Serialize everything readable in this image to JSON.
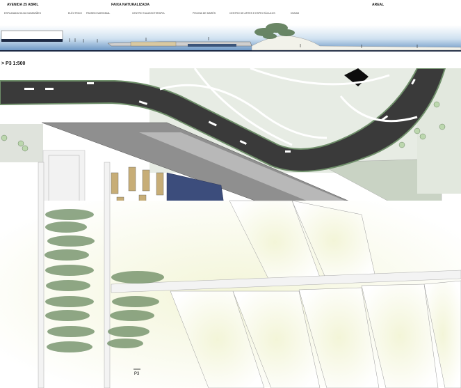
{
  "section": {
    "zones": [
      "AVENIDA 25 ABRIL",
      "FAIXA NATURALIZADA",
      "AREAL"
    ],
    "labels": [
      "ESPLANADA SILVA GUIMARÃES",
      "ELÉCTRICO",
      "PASSEIO MARGINAL",
      "CENTRO TALASSOTERAPIA",
      "PISCINA DE MARÉS",
      "CENTRO DE ARTES E ESPECTÁCULOS",
      "DUNAS"
    ]
  },
  "plan": {
    "title": "> P3 1:500",
    "section_marker": "P3",
    "colors": {
      "road": "#3a3a3a",
      "ramp": "#8f8f8f",
      "green": "#c9d3c4",
      "pool": "#3c4d7c",
      "water": "#9ac0de"
    }
  }
}
